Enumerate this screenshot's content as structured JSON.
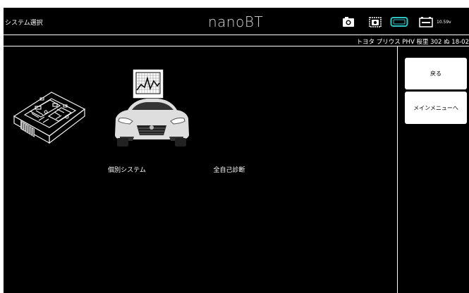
{
  "header": {
    "page_title": "システム選択",
    "brand": "nanoBT",
    "voltage": "10.59v",
    "icons": [
      "camera-icon",
      "screenshot-icon",
      "vci-connection-icon",
      "battery-icon"
    ]
  },
  "vehicle": {
    "info": "トヨタ プリウス PHV 桜里 302 ぬ 18-02"
  },
  "tiles": [
    {
      "label": "個別システム",
      "icon": "ecu-module-icon"
    },
    {
      "label": "全自己診断",
      "icon": "car-diagnosis-icon"
    }
  ],
  "sidebar": {
    "back": "戻る",
    "main_menu": "メインメニューへ"
  }
}
